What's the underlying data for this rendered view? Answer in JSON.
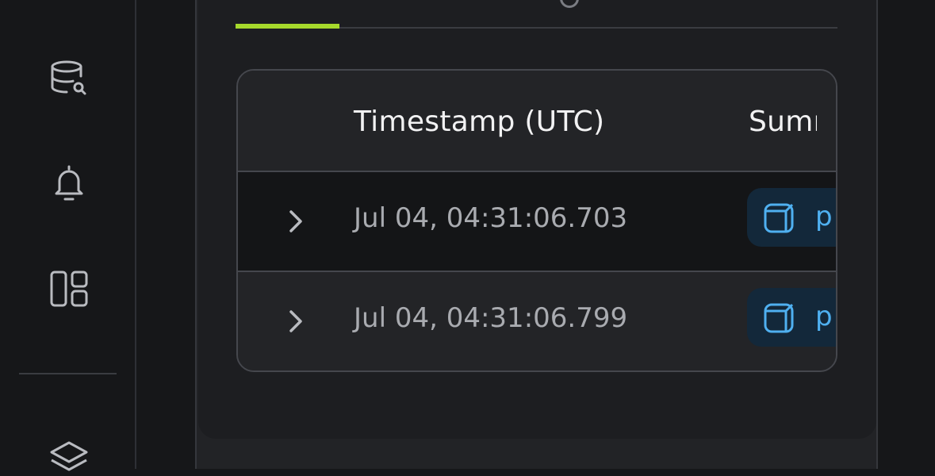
{
  "sidebar": {
    "icons": [
      "database-search-icon",
      "bell-icon",
      "layout-grid-icon",
      "layers-icon"
    ]
  },
  "table": {
    "columns": [
      "Timestamp (UTC)",
      "Summ"
    ],
    "rows": [
      {
        "timestamp": "Jul 04, 04:31:06.703",
        "summary_text": "p"
      },
      {
        "timestamp": "Jul 04, 04:31:06.799",
        "summary_text": "p"
      }
    ]
  },
  "colors": {
    "accent": "#a6d92c",
    "pill_bg": "#13283a",
    "pill_fg": "#4fb0f0"
  }
}
